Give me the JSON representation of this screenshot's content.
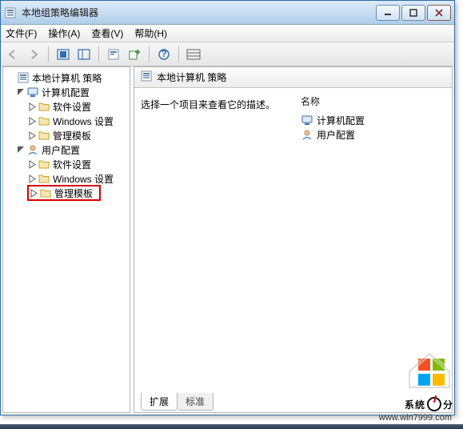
{
  "window": {
    "title": "本地组策略编辑器",
    "controls": {
      "minimize": "minimize",
      "maximize": "maximize",
      "close": "close"
    }
  },
  "menubar": {
    "file": "文件(F)",
    "action": "操作(A)",
    "view": "查看(V)",
    "help": "帮助(H)"
  },
  "toolbar": {
    "back": "back",
    "forward": "forward",
    "up": "up",
    "show_hide_tree": "show-hide",
    "properties": "properties",
    "export": "export",
    "refresh": "refresh",
    "help": "help",
    "list_view": "list"
  },
  "tree": {
    "root": {
      "label": "本地计算机 策略"
    },
    "computer": {
      "label": "计算机配置",
      "children": {
        "software": "软件设置",
        "windows": "Windows 设置",
        "admin": "管理模板"
      }
    },
    "user": {
      "label": "用户配置",
      "children": {
        "software": "软件设置",
        "windows": "Windows 设置",
        "admin": "管理模板"
      }
    }
  },
  "content": {
    "header_title": "本地计算机 策略",
    "description_prompt": "选择一个项目来查看它的描述。",
    "column_name": "名称",
    "items": {
      "computer": "计算机配置",
      "user": "用户配置"
    },
    "tabs": {
      "extended": "扩展",
      "standard": "标准"
    }
  },
  "watermark": {
    "brand": "系统",
    "brand_suffix": "分",
    "url": "www.win7999.com"
  }
}
